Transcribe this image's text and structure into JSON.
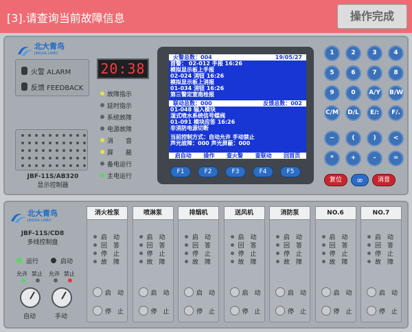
{
  "header": {
    "task": "[3].请查询当前故障信息",
    "done": "操作完成"
  },
  "upper": {
    "logo": {
      "brand": "北大青鸟",
      "sub": "JINGDA LAIBO"
    },
    "alarm_lamps": [
      {
        "label": "火警 ALARM"
      },
      {
        "label": "反馈 FEEDBACK"
      }
    ],
    "clock": "20:38",
    "statuses": [
      {
        "label": "故障指示",
        "color": "yellow"
      },
      {
        "label": "延时指示",
        "color": "off"
      },
      {
        "label": "系统故障",
        "color": "off"
      },
      {
        "label": "电源故障",
        "color": "off"
      },
      {
        "label": "消　　音",
        "color": "yellow"
      },
      {
        "label": "屏　　蔽",
        "color": "yellow"
      },
      {
        "label": "备电运行",
        "color": "off"
      },
      {
        "label": "主电运行",
        "color": "green"
      }
    ],
    "model": "JBF-11S/AB320",
    "model_sub": "显示控制器",
    "lcd": {
      "head_left": "火警总数：004",
      "head_right": "19/05/27",
      "lines": [
        "首警：  02-012   手报     16:26",
        "         模拟显示板上手报",
        "         02-024   消钮     16:26",
        "         模拟显示板上消报",
        "         01-034   消钮     16:26",
        "         第三警定室南栓报"
      ],
      "mid_left": "联动总数：000",
      "mid_right": "反馈总数：002",
      "lines2": [
        "  01-048   输入模块",
        "         湿式喷水系统信号蝶阀",
        "  01-091   模块应答          16:26",
        "         非消防电源切断"
      ],
      "lines3": [
        "  当前控制方式：自动允许  手动禁止",
        "  声光故障：000    声光屏蔽：000"
      ],
      "menu": [
        "启自动",
        "操作",
        "查火警",
        "查联动",
        "回首页"
      ]
    },
    "fkeys": [
      "F1",
      "F2",
      "F3",
      "F4",
      "F5"
    ],
    "keypad": [
      "1",
      "2",
      "3",
      "4",
      "5",
      "6",
      "7",
      "8",
      "9",
      "0",
      "A/Y",
      "B/W",
      "C/M",
      "D/L",
      "E/:",
      "F/.",
      "~",
      "(",
      ")",
      "<",
      "*",
      "+",
      "-",
      "="
    ],
    "reset": "复位",
    "loop": "∞",
    "mute": "消音"
  },
  "lower": {
    "logo": {
      "brand": "北大青鸟",
      "sub": "JINGDA LAIBO"
    },
    "model": "JBF-11S/CD8",
    "model_sub": "多线控制盘",
    "run": "运行",
    "start": "启动",
    "allow1": "允许",
    "forbid1": "禁止",
    "allow2": "允许",
    "forbid2": "禁止",
    "auto": "自动",
    "manual": "手动",
    "columns": [
      {
        "title": "消火栓泵"
      },
      {
        "title": "喷淋泵"
      },
      {
        "title": "排烟机"
      },
      {
        "title": "送风机"
      },
      {
        "title": "消防泵"
      },
      {
        "title": "NO.6"
      },
      {
        "title": "NO.7"
      }
    ],
    "col_labels": [
      "启　动",
      "回　答",
      "停　止",
      "故　障"
    ],
    "col_btns": [
      "启　动",
      "停　止"
    ]
  }
}
